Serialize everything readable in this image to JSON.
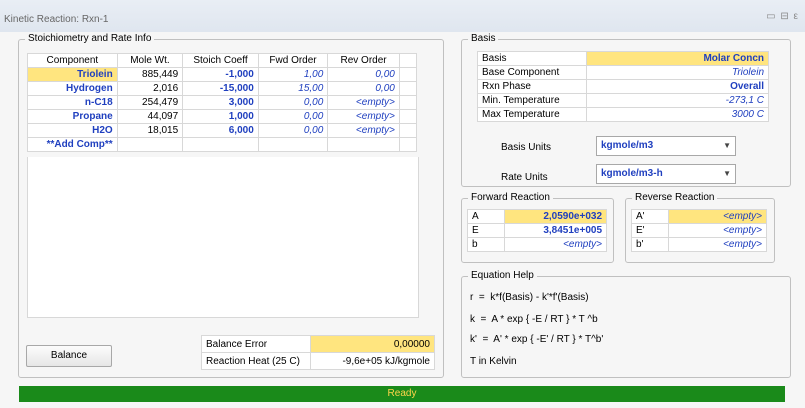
{
  "window": {
    "title": "Kinetic Reaction: Rxn-1",
    "controls": "▭ ⊟ ε"
  },
  "stoich": {
    "legend": "Stoichiometry and Rate Info",
    "headers": [
      "Component",
      "Mole Wt.",
      "Stoich Coeff",
      "Fwd Order",
      "Rev Order"
    ],
    "rows": [
      {
        "component": "Triolein",
        "mw": "885,449",
        "coeff": "-1,000",
        "fwd": "1,00",
        "rev": "0,00"
      },
      {
        "component": "Hydrogen",
        "mw": "2,016",
        "coeff": "-15,000",
        "fwd": "15,00",
        "rev": "0,00"
      },
      {
        "component": "n-C18",
        "mw": "254,479",
        "coeff": "3,000",
        "fwd": "0,00",
        "rev": "<empty>"
      },
      {
        "component": "Propane",
        "mw": "44,097",
        "coeff": "1,000",
        "fwd": "0,00",
        "rev": "<empty>"
      },
      {
        "component": "H2O",
        "mw": "18,015",
        "coeff": "6,000",
        "fwd": "0,00",
        "rev": "<empty>"
      }
    ],
    "add_comp": "**Add Comp**",
    "balance_button": "Balance",
    "balance_error_label": "Balance Error",
    "balance_error_value": "0,00000",
    "reaction_heat_label": "Reaction Heat (25 C)",
    "reaction_heat_value": "-9,6e+05 kJ/kgmole"
  },
  "basis": {
    "legend": "Basis",
    "rows": [
      {
        "label": "Basis",
        "value": "Molar Concn"
      },
      {
        "label": "Base Component",
        "value": "Triolein"
      },
      {
        "label": "Rxn Phase",
        "value": "Overall"
      },
      {
        "label": "Min. Temperature",
        "value": "-273,1 C"
      },
      {
        "label": "Max Temperature",
        "value": "3000 C"
      }
    ],
    "basis_units_label": "Basis Units",
    "basis_units_value": "kgmole/m3",
    "rate_units_label": "Rate Units",
    "rate_units_value": "kgmole/m3-h"
  },
  "forward": {
    "legend": "Forward Reaction",
    "rows": [
      {
        "label": "A",
        "value": "2,0590e+032"
      },
      {
        "label": "E",
        "value": "3,8451e+005"
      },
      {
        "label": "b",
        "value": "<empty>"
      }
    ]
  },
  "reverse": {
    "legend": "Reverse Reaction",
    "rows": [
      {
        "label": "A'",
        "value": "<empty>"
      },
      {
        "label": "E'",
        "value": "<empty>"
      },
      {
        "label": "b'",
        "value": "<empty>"
      }
    ]
  },
  "equation_help": {
    "legend": "Equation Help",
    "lines": [
      "r  =  k*f(Basis) - k'*f'(Basis)",
      "k  =  A * exp { -E / RT } * T ^b",
      "k'  =  A' * exp { -E' / RT } * T^b'",
      "T in Kelvin"
    ]
  },
  "status": {
    "text": "Ready"
  },
  "colors": {
    "highlight": "#ffe57f",
    "status_bar": "#1a8a1a",
    "value_blue": "#1f3fbf"
  }
}
